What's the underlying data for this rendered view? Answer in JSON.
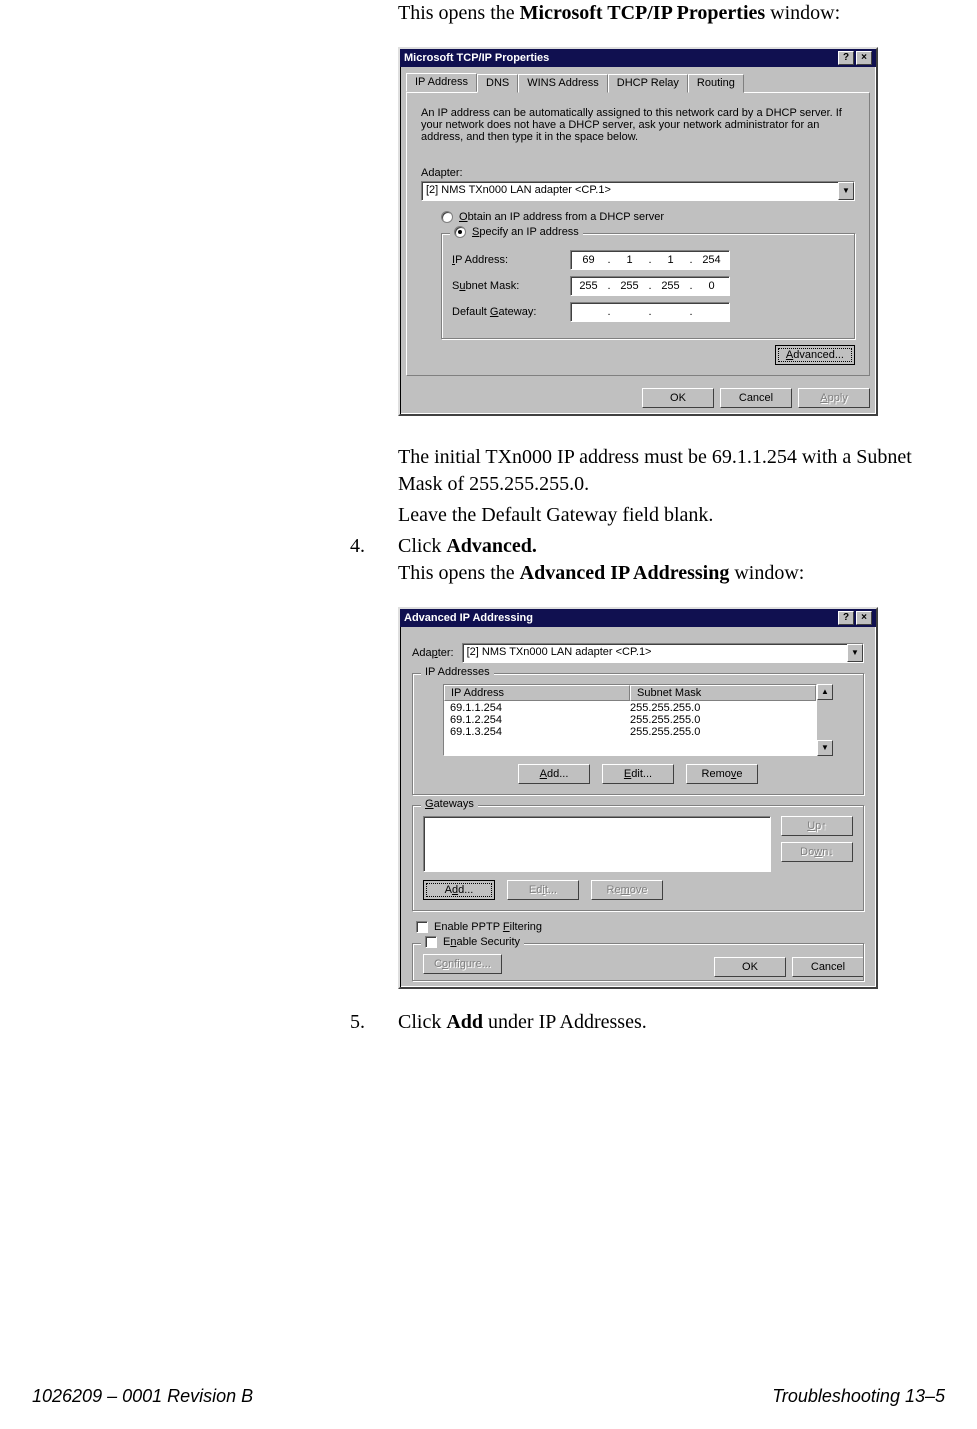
{
  "intro": {
    "line1_pre": "This opens the ",
    "line1_bold": "Microsoft TCP/IP Properties",
    "line1_post": " window:"
  },
  "dialog1": {
    "title": "Microsoft TCP/IP Properties",
    "help": "?",
    "close": "×",
    "tabs": [
      "IP Address",
      "DNS",
      "WINS Address",
      "DHCP Relay",
      "Routing"
    ],
    "desc": "An IP address can be automatically assigned to this network card by a DHCP server.  If your network does not have a DHCP server, ask your network administrator for an address, and then type it in the space below.",
    "adapter_label": "Adapter:",
    "adapter_value": "[2] NMS TXn000 LAN adapter <CP.1>",
    "radio_dhcp": "Obtain an IP address from a DHCP server",
    "radio_specify": "Specify an IP address",
    "ip_label": "IP Address:",
    "ip": [
      "69",
      "1",
      "1",
      "254"
    ],
    "mask_label": "Subnet Mask:",
    "mask": [
      "255",
      "255",
      "255",
      "0"
    ],
    "gw_label": "Default Gateway:",
    "gw": [
      "",
      "",
      "",
      ""
    ],
    "advanced": "Advanced...",
    "ok": "OK",
    "cancel": "Cancel",
    "apply": "Apply"
  },
  "mid": {
    "p1": "The initial TXn000 IP address must be 69.1.1.254 with a Subnet Mask of 255.255.255.0.",
    "p2": "Leave the Default Gateway field blank.",
    "step4_num": "4.",
    "step4_pre": "Click ",
    "step4_bold": "Advanced.",
    "step4_b_pre": "This opens the ",
    "step4_b_bold": "Advanced IP Addressing",
    "step4_b_post": " window:"
  },
  "dialog2": {
    "title": "Advanced IP Addressing",
    "help": "?",
    "close": "×",
    "adapter_label": "Adapter:",
    "adapter_value": "[2] NMS TXn000 LAN adapter <CP.1>",
    "ipaddr_legend": "IP Addresses",
    "col_ip": "IP Address",
    "col_mask": "Subnet Mask",
    "rows": [
      {
        "ip": "69.1.1.254",
        "mask": "255.255.255.0"
      },
      {
        "ip": "69.1.2.254",
        "mask": "255.255.255.0"
      },
      {
        "ip": "69.1.3.254",
        "mask": "255.255.255.0"
      }
    ],
    "add": "Add...",
    "edit": "Edit...",
    "remove": "Remove",
    "gw_legend": "Gateways",
    "up": "Up↑",
    "down": "Down↓",
    "gw_add": "Add...",
    "gw_edit": "Edit...",
    "gw_remove": "Remove",
    "pptp": "Enable PPTP Filtering",
    "sec_legend": "Enable Security",
    "configure": "Configure...",
    "ok": "OK",
    "cancel": "Cancel"
  },
  "step5": {
    "num": "5.",
    "pre": "Click ",
    "bold": "Add",
    "post": " under IP Addresses."
  },
  "footer": {
    "left": "1026209 – 0001  Revision B",
    "right": "Troubleshooting   13–5"
  }
}
